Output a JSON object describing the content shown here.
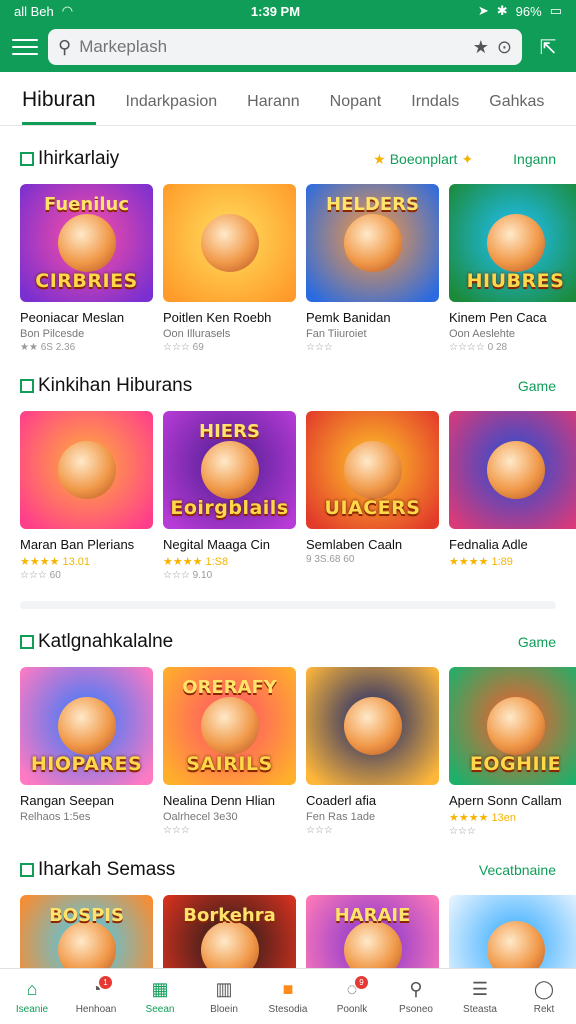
{
  "status_bar": {
    "left": "all Beh",
    "time": "1:39 PM",
    "battery": "96%"
  },
  "search": {
    "placeholder": "Markeplash"
  },
  "tabs": [
    {
      "label": "Hiburan"
    },
    {
      "label": "Indarkpasion"
    },
    {
      "label": "Harann"
    },
    {
      "label": "Nopant"
    },
    {
      "label": "Irndals"
    },
    {
      "label": "Gahkas"
    }
  ],
  "sections": [
    {
      "title": "Ihirkarlaiy",
      "link": "Boeonplart",
      "link2": "Ingann",
      "cards": [
        {
          "title": "Peoniacar Meslan",
          "sub": "Bon Pilcesde",
          "rating": "★★ 6S 2.36",
          "emblem_top": "Fueniluc",
          "emblem": "CIRBRIES",
          "c1": "#ff4fa3",
          "c2": "#7a2fd0"
        },
        {
          "title": "Poitlen Ken Roebh",
          "sub": "Oon Illurasels",
          "rating": "☆☆☆ 69",
          "emblem_top": "",
          "emblem": "",
          "c1": "#ffdf5e",
          "c2": "#ff9b2a"
        },
        {
          "title": "Pemk Banidan",
          "sub": "Fan Tiiuroiet",
          "rating": "☆☆☆",
          "emblem_top": "HELDERS",
          "emblem": "",
          "c1": "#ff9a3c",
          "c2": "#2b6be0"
        },
        {
          "title": "Kinem Pen Caca",
          "sub": "Oon Aeslehte",
          "rating": "☆☆☆☆ 0 28",
          "emblem_top": "",
          "emblem": "HIUBRES",
          "c1": "#21c2ff",
          "c2": "#1b8a3a"
        }
      ]
    },
    {
      "title": "Kinkihan Hiburans",
      "link": "Game",
      "cards": [
        {
          "title": "Maran Ban Plerians",
          "sub": "★★★★ 13.01",
          "rating": "☆☆☆ 60",
          "emblem_top": "",
          "emblem": "",
          "c1": "#ffb13a",
          "c2": "#ff3e8a"
        },
        {
          "title": "Negital Maaga Cin",
          "sub": "★★★★ 1:S8",
          "rating": "☆☆☆ 9.10",
          "emblem_top": "HIERS",
          "emblem": "Eoirgblails",
          "c1": "#4b1d8f",
          "c2": "#b73bd6"
        },
        {
          "title": "Semlaben Caaln",
          "sub": "",
          "rating": "9 3S.68 60",
          "emblem_top": "",
          "emblem": "UIACERS",
          "c1": "#ffc629",
          "c2": "#e23b2a"
        },
        {
          "title": "Fednalia Adle",
          "sub": "★★★★ 1:89",
          "rating": "",
          "emblem_top": "",
          "emblem": "",
          "c1": "#1d4fd8",
          "c2": "#d93a7a"
        }
      ]
    },
    {
      "title": "Katlgnahkalalne",
      "link": "Game",
      "cards": [
        {
          "title": "Rangan Seepan",
          "sub": "Relhaos 1:5es",
          "rating": "",
          "emblem_top": "",
          "emblem": "HIOPARES",
          "c1": "#2a7bff",
          "c2": "#ff7ac2"
        },
        {
          "title": "Nealina Denn Hlian",
          "sub": "Oalrhecel 3e30",
          "rating": "☆☆☆",
          "emblem_top": "ORERAFY",
          "emblem": "SAIRILS",
          "c1": "#ff4f6b",
          "c2": "#ffb02b"
        },
        {
          "title": "Coaderl afia",
          "sub": "Fen Ras 1ade",
          "rating": "☆☆☆",
          "emblem_top": "",
          "emblem": "",
          "c1": "#0d1f6e",
          "c2": "#ffb73a"
        },
        {
          "title": "Apern Sonn Callam",
          "sub": "★★★★ 13en",
          "rating": "☆☆☆",
          "emblem_top": "",
          "emblem": "EOGHIIE",
          "c1": "#ff5a2b",
          "c2": "#1db06a"
        }
      ]
    },
    {
      "title": "Iharkah  Semass",
      "link": "Vecatbnaine",
      "cards": [
        {
          "title": "",
          "sub": "",
          "rating": "",
          "emblem_top": "BOSPIS",
          "emblem": "",
          "c1": "#3ad0ff",
          "c2": "#ff8a2b"
        },
        {
          "title": "",
          "sub": "",
          "rating": "",
          "emblem_top": "Borkehra",
          "emblem": "",
          "c1": "#1a1a1a",
          "c2": "#d9321f"
        },
        {
          "title": "",
          "sub": "",
          "rating": "",
          "emblem_top": "HARAIE",
          "emblem": "",
          "c1": "#7a2fd0",
          "c2": "#ff7ab8"
        },
        {
          "title": "",
          "sub": "",
          "rating": "",
          "emblem_top": "",
          "emblem": "",
          "c1": "#2aa7ff",
          "c2": "#e8f4ff"
        }
      ]
    }
  ],
  "bottom_nav": [
    {
      "label": "Iseanie",
      "icon": "home-icon",
      "glyph": "⌂",
      "active": true,
      "badge": ""
    },
    {
      "label": "Henhoan",
      "icon": "gauge-icon",
      "glyph": "◔",
      "active": false,
      "badge": "1"
    },
    {
      "label": "Seean",
      "icon": "ticket-icon",
      "glyph": "▦",
      "active": true,
      "badge": ""
    },
    {
      "label": "Bloein",
      "icon": "book-icon",
      "glyph": "▥",
      "active": false,
      "badge": ""
    },
    {
      "label": "Stesodia",
      "icon": "folder-icon",
      "glyph": "■",
      "active": false,
      "badge": ""
    },
    {
      "label": "Poonlk",
      "icon": "chat-icon",
      "glyph": "◌",
      "active": false,
      "badge": "9"
    },
    {
      "label": "Psoneo",
      "icon": "search-icon",
      "glyph": "⚲",
      "active": false,
      "badge": ""
    },
    {
      "label": "Steasta",
      "icon": "list-icon",
      "glyph": "☰",
      "active": false,
      "badge": ""
    },
    {
      "label": "Rekt",
      "icon": "person-icon",
      "glyph": "◯",
      "active": false,
      "badge": ""
    }
  ]
}
